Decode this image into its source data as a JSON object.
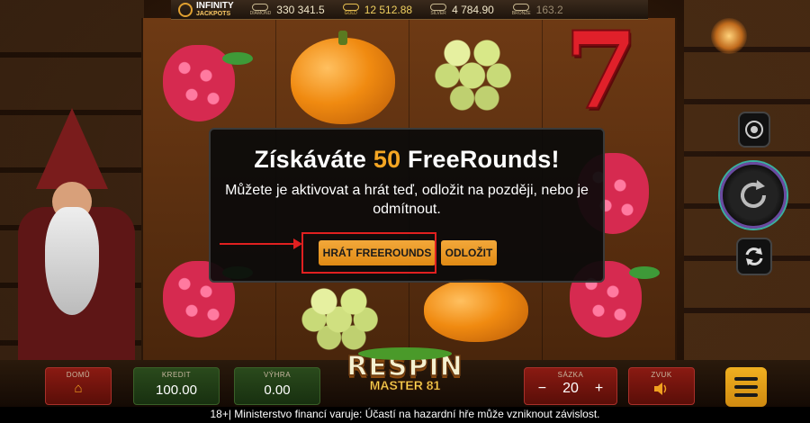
{
  "jackpots": {
    "logo_title": "INFINITY",
    "logo_sub": "JACKPOTS",
    "items": [
      {
        "icon": "diamond-jackpot-icon",
        "tier": "DIAMOND",
        "value": "330 341.5"
      },
      {
        "icon": "gold-jackpot-icon",
        "tier": "GOLD",
        "value": "12 512.88"
      },
      {
        "icon": "silver-jackpot-icon",
        "tier": "SILVER",
        "value": "4 784.90"
      },
      {
        "icon": "bronze-jackpot-icon",
        "tier": "BRONZE",
        "value": "163.2"
      }
    ]
  },
  "modal": {
    "title_prefix": "Získáváte",
    "title_number": "50",
    "title_suffix": "FreeRounds!",
    "message": "Můžete je aktivovat a hrát teď, odložit na později, nebo je odmítnout.",
    "play_label": "HRÁT FREEROUNDS",
    "later_label": "ODLOŽIT"
  },
  "bottom": {
    "home_label": "DOMŮ",
    "credit_label": "KREDIT",
    "credit_value": "100.00",
    "win_label": "VÝHRA",
    "win_value": "0.00",
    "stake_label": "SÁZKA",
    "stake_minus": "−",
    "stake_value": "20",
    "stake_plus": "+",
    "sound_label": "ZVUK"
  },
  "logo": {
    "title": "RESPIN",
    "subtitle": "MASTER 81"
  },
  "warning": "18+| Ministerstvo financí varuje: Účastí na hazardní hře může vzniknout závislost.",
  "colors": {
    "accent_orange": "#f5a623",
    "highlight_red": "#e02020"
  }
}
